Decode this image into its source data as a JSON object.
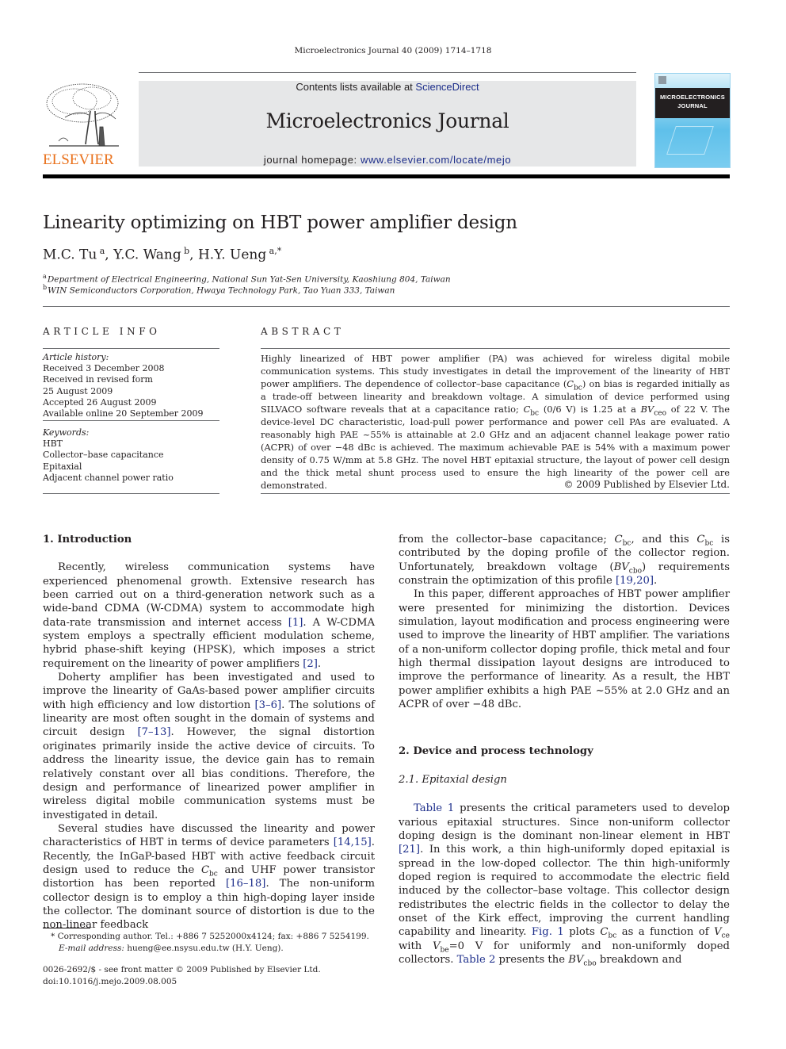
{
  "running_head": "Microelectronics Journal 40 (2009) 1714–1718",
  "masthead": {
    "publisher_logo_text": "ELSEVIER",
    "contents_prefix": "Contents lists available at ",
    "contents_link": "ScienceDirect",
    "journal_title": "Microelectronics Journal",
    "homepage_prefix": "journal homepage: ",
    "homepage_link": "www.elsevier.com/locate/mejo",
    "cover_title_line1": "MICROELECTRONICS",
    "cover_title_line2": "JOURNAL",
    "colors": {
      "elsevier_orange": "#e9711c",
      "link_blue": "#1c2d8a",
      "masthead_grey": "#e6e7e8",
      "cover_blue": "#5fc0ea"
    }
  },
  "article": {
    "title": "Linearity optimizing on HBT power amplifier design",
    "authors": [
      {
        "name": "M.C. Tu",
        "sup": "a"
      },
      {
        "name": "Y.C. Wang",
        "sup": "b"
      },
      {
        "name": "H.Y. Ueng",
        "sup": "a,*"
      }
    ],
    "affiliations": [
      {
        "sup": "a",
        "text": "Department of Electrical Engineering, National Sun Yat-Sen University, Kaoshiung 804, Taiwan"
      },
      {
        "sup": "b",
        "text": "WIN Semiconductors Corporation, Hwaya Technology Park, Tao Yuan 333, Taiwan"
      }
    ]
  },
  "article_info": {
    "heading": "ARTICLE INFO",
    "history_label": "Article history:",
    "history": [
      "Received 3 December 2008",
      "Received in revised form",
      "25 August 2009",
      "Accepted 26 August 2009",
      "Available online 20 September 2009"
    ],
    "keywords_label": "Keywords:",
    "keywords": [
      "HBT",
      "Collector–base capacitance",
      "Epitaxial",
      "Adjacent channel power ratio"
    ]
  },
  "abstract": {
    "heading": "ABSTRACT",
    "t1": "Highly linearized of HBT power amplifier (PA) was achieved for wireless digital mobile communication systems. This study investigates in detail the improvement of the linearity of HBT power amplifiers. The dependence of collector–base capacitance (",
    "C": "C",
    "bc": "bc",
    "t2": ") on bias is regarded initially as a trade-off between linearity and breakdown voltage. A simulation of device performed using SILVACO software reveals that at a capacitance ratio; ",
    "t3": " (0/6 V) is 1.25 at a ",
    "BV": "BV",
    "ceo": "ceo",
    "t4": " of 22 V. The device-level DC characteristic, load-pull power performance and power cell PAs are evaluated. A reasonably high PAE ~55% is attainable at 2.0 GHz and an adjacent channel leakage power ratio (ACPR) of over −48 dBc is achieved. The maximum achievable PAE is 54% with a maximum power density of 0.75 W/mm at 5.8 GHz. The novel HBT epitaxial structure, the layout of power cell design and the thick metal shunt process used to ensure the high linearity of the power cell are demonstrated.",
    "copyright": "© 2009 Published by Elsevier Ltd."
  },
  "body": {
    "sec1_heading": "1.  Introduction",
    "p1a": "Recently, wireless communication systems have experienced phenomenal growth. Extensive research has been carried out on a third-generation network such as a wide-band CDMA (W-CDMA) system to accommodate high data-rate transmission and internet access ",
    "ref1": "[1]",
    "p1b": ". A W-CDMA system employs a spectrally efficient modulation scheme, hybrid phase-shift keying (HPSK), which imposes a strict requirement on the linearity of power amplifiers ",
    "ref2": "[2]",
    "p1c": ".",
    "p2a": "Doherty amplifier has been investigated and used to improve the linearity of GaAs-based power amplifier circuits with high efficiency and low distortion ",
    "ref3": "[3–6]",
    "p2b": ". The solutions of linearity are most often sought in the domain of systems and circuit design ",
    "ref4": "[7–13]",
    "p2c": ". However, the signal distortion originates primarily inside the active device of circuits. To address the linearity issue, the device gain has to remain relatively constant over all bias conditions. Therefore, the design and performance of linearized power amplifier in wireless digital mobile communication systems must be investigated in detail.",
    "p3a": "Several studies have discussed the linearity and power characteristics of HBT in terms of device parameters ",
    "ref5": "[14,15]",
    "p3b": ". Recently, the InGaP-based HBT with active feedback circuit design used to reduce the ",
    "p3c": " and UHF power transistor distortion has been reported ",
    "ref6": "[16–18]",
    "p3d": ". The non-uniform collector design is to employ a thin high-doping layer inside the collector. The dominant source of distortion is due to the non-linear feedback",
    "r1a": "from the collector–base capacitance; ",
    "r1b": ", and this ",
    "r1c": " is contributed by the doping profile of the collector region. Unfortunately, breakdown voltage (",
    "cbo": "cbo",
    "r1d": ") requirements constrain the optimization of this profile ",
    "ref7": "[19,20]",
    "r1e": ".",
    "r2": "In this paper, different approaches of HBT power amplifier were presented for minimizing the distortion. Devices simulation, layout modification and process engineering were used to improve the linearity of HBT amplifier. The variations of a non-uniform collector doping profile, thick metal and four high thermal dissipation layout designs are introduced to improve the performance of linearity. As a result, the HBT power amplifier exhibits a high PAE ~55% at 2.0 GHz and an ACPR of over −48 dBc.",
    "sec2_heading": "2.  Device and process technology",
    "sec21_heading": "2.1.  Epitaxial design",
    "table1": "Table 1",
    "r3a": " presents the critical parameters used to develop various epitaxial structures. Since non-uniform collector doping design is the dominant non-linear element in HBT ",
    "ref8": "[21]",
    "r3b": ". In this work, a thin high-uniformly doped epitaxial is spread in the low-doped collector. The thin high-uniformly doped region is required to accommodate the electric field induced by the collector–base voltage. This collector design redistributes the electric fields in the collector to delay the onset of the Kirk effect, improving the current handling capability and linearity. ",
    "fig1": "Fig. 1",
    "r3c": " plots ",
    "r3d": " as a function of ",
    "V": "V",
    "ce": "ce",
    "r3e": " with ",
    "be": "be",
    "r3f": "=0 V for uniformly and non-uniformly doped collectors. ",
    "table2": "Table 2",
    "r3g": " presents the ",
    "r3h": " breakdown and"
  },
  "footnote": {
    "corresponding": "* Corresponding author. Tel.: +886 7 5252000x4124; fax: +886 7 5254199.",
    "email_label": "E-mail address:",
    "email": " hueng@ee.nsysu.edu.tw (H.Y. Ueng).",
    "front_matter": "0026-2692/$ - see front matter © 2009 Published by Elsevier Ltd.",
    "doi": "doi:10.1016/j.mejo.2009.08.005"
  }
}
